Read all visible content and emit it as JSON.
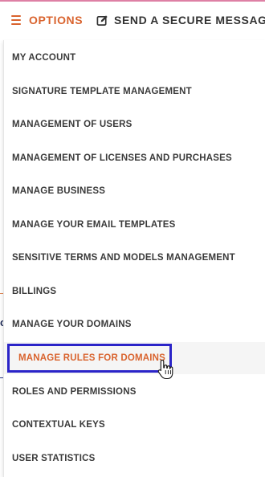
{
  "header": {
    "options_label": "OPTIONS",
    "send_label": "SEND A SECURE MESSAGE"
  },
  "menu": {
    "items": [
      {
        "label": "MY ACCOUNT"
      },
      {
        "label": "SIGNATURE TEMPLATE MANAGEMENT"
      },
      {
        "label": "MANAGEMENT OF USERS"
      },
      {
        "label": "MANAGEMENT OF LICENSES AND PURCHASES"
      },
      {
        "label": "MANAGE BUSINESS"
      },
      {
        "label": "MANAGE YOUR EMAIL TEMPLATES"
      },
      {
        "label": "SENSITIVE TERMS AND MODELS MANAGEMENT"
      },
      {
        "label": "BILLINGS"
      },
      {
        "label": "MANAGE YOUR DOMAINS"
      },
      {
        "label": "MANAGE RULES FOR DOMAINS",
        "active": true
      },
      {
        "label": "ROLES AND PERMISSIONS"
      },
      {
        "label": "CONTEXTUAL KEYS"
      },
      {
        "label": "USER STATISTICS"
      }
    ]
  },
  "colors": {
    "accent": "#d9632e",
    "highlight_border": "#2b24c8",
    "text": "#3a3a3a"
  },
  "icons": {
    "options": "hamburger-icon",
    "send": "edit-icon",
    "cursor": "hand-pointer-icon"
  }
}
